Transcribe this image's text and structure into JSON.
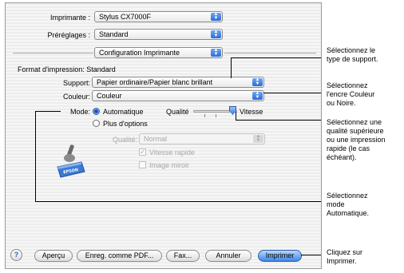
{
  "print_dialog": {
    "printer_label": "Imprimante :",
    "printer_value": "Stylus CX7000F",
    "presets_label": "Préréglages :",
    "presets_value": "Standard",
    "panel_value": "Configuration Imprimante",
    "paper_format_label": "Format d'impression:",
    "paper_format_value": "Standard",
    "media_label": "Support:",
    "media_value": "Papier ordinaire/Papier blanc brillant",
    "color_label": "Couleur:",
    "color_value": "Couleur",
    "mode_label": "Mode:",
    "mode_auto_label": "Automatique",
    "mode_custom_label": "Plus d'options",
    "quality_slider_label": "Qualité",
    "speed_label": "Vitesse",
    "quality_popup_label": "Qualité:",
    "quality_popup_value": "Normal",
    "fast_speed_label": "Vitesse rapide",
    "fast_speed_checked": true,
    "mirror_label": "Image miroir",
    "mirror_checked": false,
    "logo_text": "EPSON"
  },
  "buttons": {
    "help": "?",
    "preview": "Aperçu",
    "save_pdf": "Enreg. comme PDF...",
    "fax": "Fax...",
    "cancel": "Annuler",
    "print": "Imprimer"
  },
  "callouts": {
    "media": "Sélectionnez le\ntype de support.",
    "color": "Sélectionnez\nl'encre Couleur\nou Noire.",
    "quality": "Sélectionnez une\nqualité supérieure\nou une impression\nrapide (le cas\néchéant).",
    "mode": "Sélectionnez\nmode\nAutomatique.",
    "print": "Cliquez sur\nImprimer."
  },
  "colors": {
    "accent": "#3f86e6",
    "dialog_background": "#ededed"
  }
}
